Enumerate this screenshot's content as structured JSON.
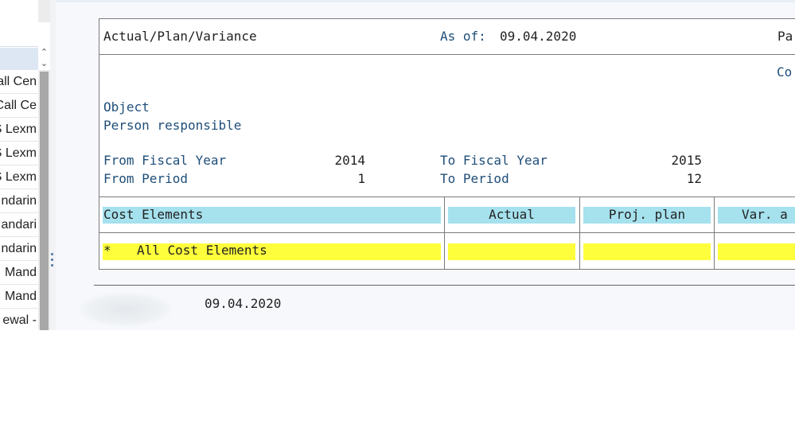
{
  "nav": {
    "items": [
      "all Cen",
      "Call Ce",
      "S Lexm",
      "S Lexm",
      "S Lexm",
      "ndarin",
      "andari",
      "ndarin",
      "Mand",
      "Mand",
      "ewal -"
    ]
  },
  "report": {
    "title": "Actual/Plan/Variance",
    "as_of_label": "As of:",
    "as_of_date": "09.04.2020",
    "page_label_partial": "Pa",
    "co_label_partial": "Co",
    "object_label": "Object",
    "person_label": "Person responsible",
    "from_fy_label": "From Fiscal Year",
    "from_fy_value": "2014",
    "to_fy_label": "To Fiscal Year",
    "to_fy_value": "2015",
    "from_period_label": "From Period",
    "from_period_value": "1",
    "to_period_label": "To Period",
    "to_period_value": "12",
    "columns": [
      "Cost Elements",
      "Actual",
      "Proj. plan",
      "Var. a"
    ],
    "row": {
      "marker": "*",
      "label": "All Cost Elements"
    }
  },
  "footer": {
    "date": "09.04.2020"
  },
  "colors": {
    "header_fill": "#a6e1ee",
    "row_fill": "#fefe3c",
    "label_blue": "#1f4e79"
  }
}
